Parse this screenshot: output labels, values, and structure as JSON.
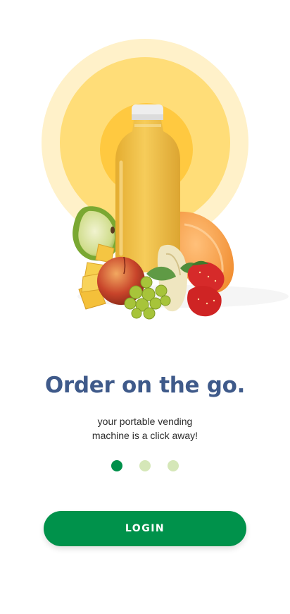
{
  "hero": {
    "image_name": "juice-bottle-with-fruits",
    "colors": {
      "sun_outer": "#fff1c9",
      "sun_middle": "#ffdd78",
      "sun_inner": "#ffc940",
      "juice": "#f2c24a",
      "cap": "#eeeeee"
    }
  },
  "onboarding": {
    "headline": "Order on the go.",
    "subtitle_line1": "your portable vending",
    "subtitle_line2": "machine is a click away!",
    "page_count": 3,
    "active_page": 1
  },
  "login_button": {
    "label": "LOGIN",
    "color": "#00924b"
  },
  "colors": {
    "headline": "#3f5a8a",
    "dot_active": "#00904a",
    "dot_inactive": "#d5e7b8"
  }
}
